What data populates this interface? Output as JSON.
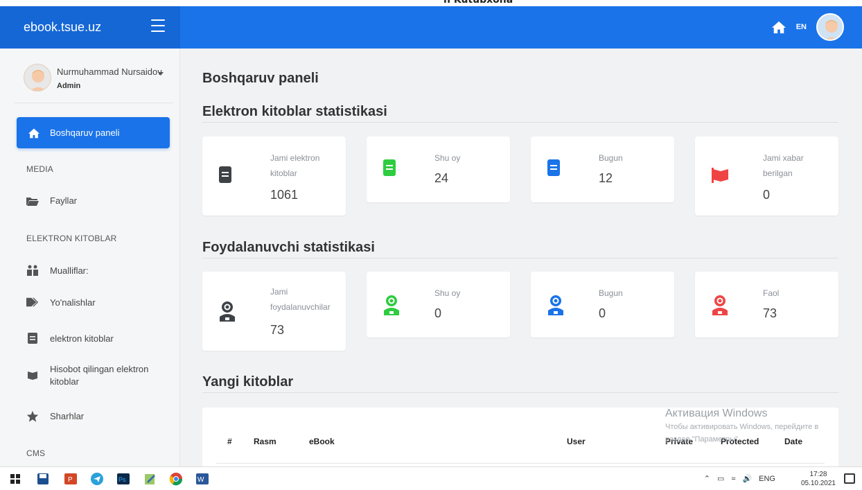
{
  "top_strip": {
    "clipped_text": "n Kutubxona"
  },
  "header": {
    "brand": "ebook.tsue.uz",
    "lang": "EN"
  },
  "sidebar": {
    "user_name": "Nurmuhammad Nursaidov",
    "user_role": "Admin",
    "active_item": "Boshqaruv paneli",
    "sections": [
      {
        "title": "MEDIA"
      },
      {
        "title": "ELEKTRON KITOBLAR"
      },
      {
        "title": "CMS"
      }
    ],
    "items": [
      {
        "label": "Fayllar",
        "icon": "folder-icon"
      },
      {
        "label": "Mualliflar:",
        "icon": "authors-icon"
      },
      {
        "label": "Yo'nalishlar",
        "icon": "tags-icon"
      },
      {
        "label": "elektron kitoblar",
        "icon": "book-icon"
      },
      {
        "label": "Hisobot qilingan elektron kitoblar",
        "icon": "flag-icon"
      },
      {
        "label": "Sharhlar",
        "icon": "star-icon"
      }
    ]
  },
  "main": {
    "page_title": "Boshqaruv paneli",
    "ebook_stats_title": "Elektron kitoblar statistikasi",
    "ebook_stats": [
      {
        "label": "Jami elektron kitoblar",
        "value": "1061",
        "color": "#3d4247"
      },
      {
        "label": "Shu oy",
        "value": "24",
        "color": "#2ecc40"
      },
      {
        "label": "Bugun",
        "value": "12",
        "color": "#1a73e8"
      },
      {
        "label": "Jami xabar berilgan",
        "value": "0",
        "color": "#ef4444"
      }
    ],
    "user_stats_title": "Foydalanuvchi statistikasi",
    "user_stats": [
      {
        "label": "Jami foydalanuvchilar",
        "value": "73",
        "color": "#3d4247"
      },
      {
        "label": "Shu oy",
        "value": "0",
        "color": "#2ecc40"
      },
      {
        "label": "Bugun",
        "value": "0",
        "color": "#1a73e8"
      },
      {
        "label": "Faol",
        "value": "73",
        "color": "#ef4444"
      }
    ],
    "new_books_title": "Yangi kitoblar",
    "table_headers": [
      "#",
      "Rasm",
      "eBook",
      "User",
      "Private",
      "Protected",
      "Date"
    ],
    "watermark": {
      "line1": "Активация Windows",
      "line2": "Чтобы активировать Windows, перейдите в",
      "line3": "раздел \"Параметры\"."
    }
  },
  "taskbar": {
    "lang": "ENG",
    "time": "17:28",
    "date": "05.10.2021"
  }
}
